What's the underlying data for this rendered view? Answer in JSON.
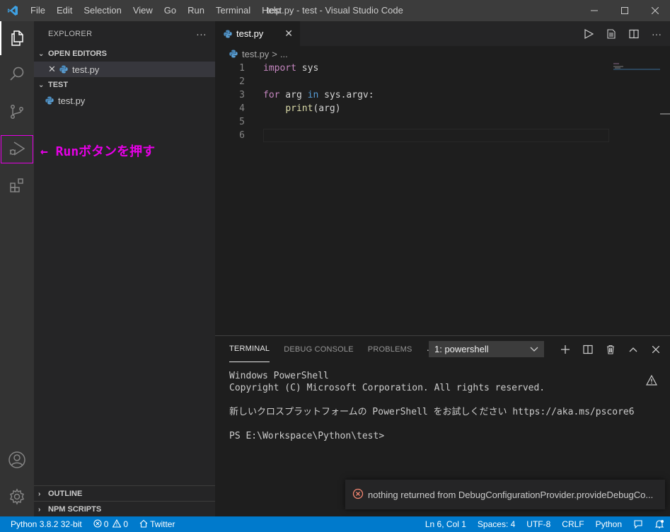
{
  "window": {
    "title": "test.py - test - Visual Studio Code",
    "menu": [
      "File",
      "Edit",
      "Selection",
      "View",
      "Go",
      "Run",
      "Terminal",
      "Help"
    ]
  },
  "activity_bar": {
    "items": [
      "explorer-icon",
      "search-icon",
      "source-control-icon",
      "run-debug-icon",
      "extensions-icon"
    ],
    "bottom": [
      "account-icon",
      "manage-gear-icon"
    ]
  },
  "annotation": "← Runボタンを押す",
  "sidebar": {
    "title": "EXPLORER",
    "more": "···",
    "open_editors": {
      "label": "OPEN EDITORS",
      "files": [
        {
          "close": "✕",
          "name": "test.py"
        }
      ]
    },
    "folder": {
      "label": "TEST",
      "files": [
        {
          "name": "test.py"
        }
      ]
    },
    "outline": "OUTLINE",
    "npm_scripts": "NPM SCRIPTS"
  },
  "editor": {
    "tab": {
      "name": "test.py",
      "close": "✕"
    },
    "breadcrumb": {
      "file": "test.py",
      "sep": ">",
      "rest": "..."
    },
    "lines": [
      {
        "n": "1",
        "parts": [
          {
            "t": "import",
            "c": "kw"
          },
          {
            "t": " sys",
            "c": ""
          }
        ]
      },
      {
        "n": "2",
        "parts": []
      },
      {
        "n": "3",
        "parts": [
          {
            "t": "for",
            "c": "kw"
          },
          {
            "t": " arg ",
            "c": ""
          },
          {
            "t": "in",
            "c": "kw2"
          },
          {
            "t": " sys.argv:",
            "c": ""
          }
        ]
      },
      {
        "n": "4",
        "parts": [
          {
            "t": "    ",
            "c": ""
          },
          {
            "t": "print",
            "c": "fn"
          },
          {
            "t": "(arg)",
            "c": ""
          }
        ]
      },
      {
        "n": "5",
        "parts": []
      },
      {
        "n": "6",
        "parts": []
      }
    ]
  },
  "panel": {
    "tabs": [
      "TERMINAL",
      "DEBUG CONSOLE",
      "PROBLEMS"
    ],
    "more": "···",
    "terminal_select": "1: powershell",
    "terminal_lines": [
      "Windows PowerShell",
      "Copyright (C) Microsoft Corporation. All rights reserved.",
      "",
      "新しいクロスプラットフォームの PowerShell をお試しください https://aka.ms/pscore6",
      "",
      "PS E:\\Workspace\\Python\\test>"
    ]
  },
  "notification": {
    "message": "nothing returned from DebugConfigurationProvider.provideDebugCo..."
  },
  "statusbar": {
    "python": "Python 3.8.2 32-bit",
    "errors": "0",
    "warnings": "0",
    "twitter": "Twitter",
    "position": "Ln 6, Col 1",
    "spaces": "Spaces: 4",
    "encoding": "UTF-8",
    "eol": "CRLF",
    "language": "Python"
  },
  "colors": {
    "accent": "#007acc",
    "annotation": "#e600e6",
    "error": "#f48771"
  }
}
